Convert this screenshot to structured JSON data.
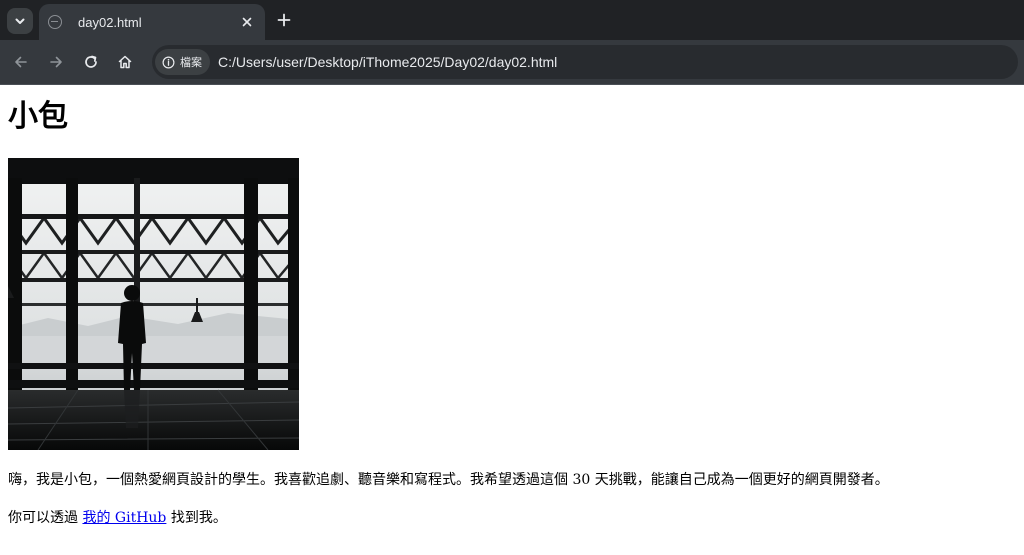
{
  "browser": {
    "tab_title": "day02.html",
    "site_chip_label": "檔案",
    "url": "C:/Users/user/Desktop/iThome2025/Day02/day02.html",
    "colors": {
      "tabstrip": "#202225",
      "toolbar": "#35393e",
      "omnibox": "#282b2f",
      "text": "#e8eaed"
    },
    "icons": {
      "tab_search": "chevron-down-icon",
      "favicon": "globe-icon",
      "close": "close-icon",
      "new_tab": "plus-icon",
      "back": "arrow-left-icon",
      "forward": "arrow-right-icon",
      "reload": "reload-icon",
      "home": "home-icon",
      "site_info": "info-icon"
    }
  },
  "page": {
    "title": "小包",
    "intro": "嗨，我是小包，一個熱愛網頁設計的學生。我喜歡追劇、聽音樂和寫程式。我希望透過這個 30 天挑戰，能讓自己成為一個更好的網頁開發者。",
    "contact_prefix": "你可以透過",
    "link_label": "我的 GitHub",
    "contact_suffix": "找到我。",
    "link_color": "#0000ee"
  }
}
